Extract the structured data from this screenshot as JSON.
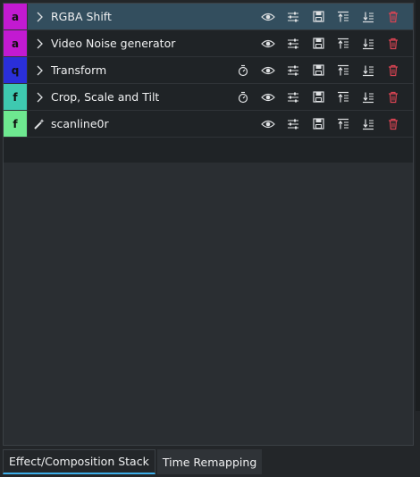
{
  "effects": [
    {
      "badge": "a",
      "badge_color": "#c21ad1",
      "expander": "chevron-right-icon",
      "name": "RGBA Shift",
      "has_keyframe_icon": false,
      "selected": true
    },
    {
      "badge": "a",
      "badge_color": "#c21ad1",
      "expander": "chevron-right-icon",
      "name": "Video Noise generator",
      "has_keyframe_icon": false,
      "selected": false
    },
    {
      "badge": "q",
      "badge_color": "#2a2fd9",
      "expander": "chevron-right-icon",
      "name": "Transform",
      "has_keyframe_icon": true,
      "selected": false
    },
    {
      "badge": "f",
      "badge_color": "#3ec9b0",
      "expander": "chevron-right-icon",
      "name": "Crop, Scale and Tilt",
      "has_keyframe_icon": true,
      "selected": false
    },
    {
      "badge": "f",
      "badge_color": "#6ee890",
      "expander": "magic-wand-icon",
      "name": "scanline0r",
      "has_keyframe_icon": false,
      "selected": false
    }
  ],
  "row_icons": [
    "eye-icon",
    "sliders-icon",
    "save-icon",
    "move-up-icon",
    "move-down-icon",
    "delete-icon"
  ],
  "tabs": [
    {
      "label": "Effect/Composition Stack",
      "active": true
    },
    {
      "label": "Time Remapping",
      "active": false
    }
  ],
  "colors": {
    "accent": "#3daee9",
    "delete": "#da4453",
    "selected_row": "#334e5e"
  }
}
